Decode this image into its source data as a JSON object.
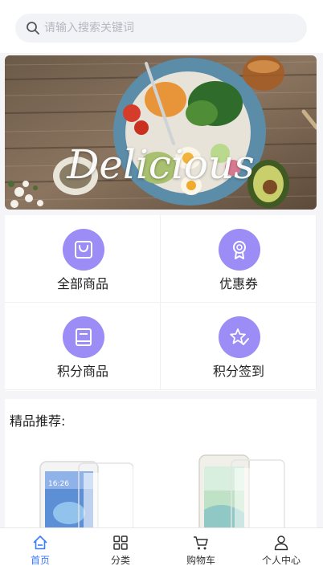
{
  "search": {
    "placeholder": "请输入搜索关键词",
    "icon": "search-icon"
  },
  "banner": {
    "text": "Delicious"
  },
  "categories": [
    {
      "label": "全部商品",
      "icon": "shopping-bag-icon"
    },
    {
      "label": "优惠券",
      "icon": "badge-icon"
    },
    {
      "label": "积分商品",
      "icon": "book-icon"
    },
    {
      "label": "积分签到",
      "icon": "star-check-icon"
    }
  ],
  "recommend": {
    "title": "精品推荐:"
  },
  "products": [
    {
      "name": "phone-1",
      "screen_time": "16:26"
    },
    {
      "name": "phone-2"
    }
  ],
  "tabbar": {
    "items": [
      {
        "label": "首页",
        "icon": "home-icon",
        "active": true
      },
      {
        "label": "分类",
        "icon": "grid-icon"
      },
      {
        "label": "购物车",
        "icon": "cart-icon"
      },
      {
        "label": "个人中心",
        "icon": "user-icon"
      }
    ]
  },
  "colors": {
    "accent": "#3a7bff",
    "icon_circle": "#9b8cf6",
    "background": "#f5f5f7"
  }
}
